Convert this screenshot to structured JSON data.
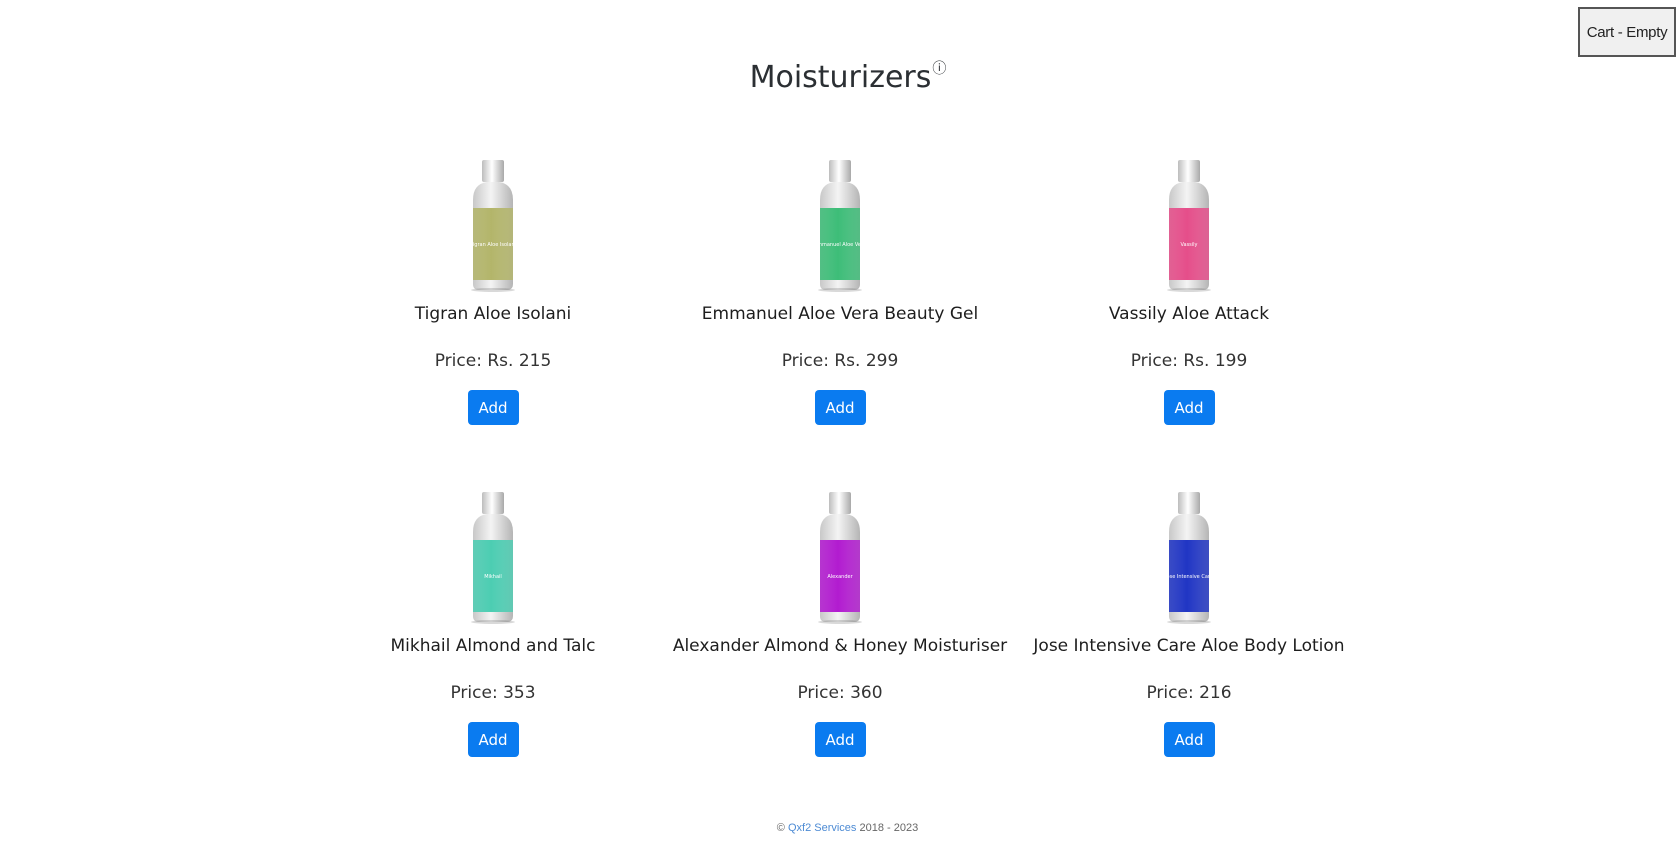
{
  "cart": {
    "label": "Cart - Empty"
  },
  "page": {
    "title": "Moisturizers",
    "info_icon": "ⓘ"
  },
  "products": [
    {
      "name": "Tigran Aloe Isolani",
      "price": "Price: Rs. 215",
      "add_label": "Add",
      "bottle_color": "#b3b56a",
      "bottle_text": "Tigran Aloe Isolani"
    },
    {
      "name": "Emmanuel Aloe Vera Beauty Gel",
      "price": "Price: Rs. 299",
      "add_label": "Add",
      "bottle_color": "#3dbd78",
      "bottle_text": "Emmanuel Aloe Vera"
    },
    {
      "name": "Vassily Aloe Attack",
      "price": "Price: Rs. 199",
      "add_label": "Add",
      "bottle_color": "#e54e8a",
      "bottle_text": "Vassily"
    },
    {
      "name": "Mikhail Almond and Talc",
      "price": "Price: 353",
      "add_label": "Add",
      "bottle_color": "#4ccdb2",
      "bottle_text": "Mikhail"
    },
    {
      "name": "Alexander Almond & Honey Moisturiser",
      "price": "Price: 360",
      "add_label": "Add",
      "bottle_color": "#b21bd0",
      "bottle_text": "Alexander"
    },
    {
      "name": "Jose Intensive Care Aloe Body Lotion",
      "price": "Price: 216",
      "add_label": "Add",
      "bottle_color": "#2035c4",
      "bottle_text": "Jose Intensive Care"
    }
  ],
  "footer": {
    "copyright": "©",
    "link": "Qxf2 Services",
    "years": "2018 - 2023"
  }
}
